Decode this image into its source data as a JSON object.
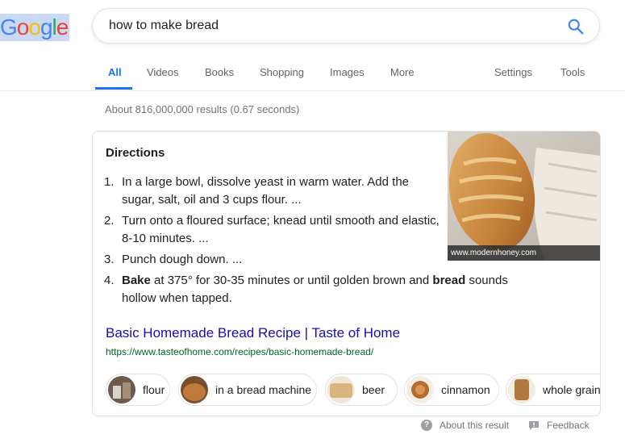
{
  "logo": {
    "letters": [
      "G",
      "o",
      "o",
      "g",
      "l",
      "e"
    ]
  },
  "search": {
    "query": "how to make bread"
  },
  "tabs": {
    "all": "All",
    "videos": "Videos",
    "books": "Books",
    "shopping": "Shopping",
    "images": "Images",
    "more": "More",
    "settings": "Settings",
    "tools": "Tools"
  },
  "result_stats": "About 816,000,000 results (0.67 seconds)",
  "snippet": {
    "title": "Directions",
    "steps": [
      {
        "num": "1.",
        "text": "In a large bowl, dissolve yeast in warm water. Add the sugar, salt, oil and 3 cups flour. ..."
      },
      {
        "num": "2.",
        "text": "Turn onto a floured surface; knead until smooth and elastic, 8-10 minutes. ..."
      },
      {
        "num": "3.",
        "text": "Punch dough down. ..."
      },
      {
        "num": "4.",
        "bold1": "Bake",
        "text_a": " at 375° for 30-35 minutes or until golden brown and ",
        "bold2": "bread",
        "text_b": " sounds hollow when tapped."
      }
    ],
    "image_caption": "www.modernhoney.com",
    "result_title": "Basic Homemade Bread Recipe | Taste of Home",
    "result_url": "https://www.tasteofhome.com/recipes/basic-homemade-bread/",
    "chips": [
      "flour",
      "in a bread machine",
      "beer",
      "cinnamon",
      "whole grain"
    ]
  },
  "footer": {
    "about": "About this result",
    "feedback": "Feedback"
  },
  "colors": {
    "link": "#1a0dab",
    "url": "#006621",
    "accent": "#1a73e8"
  }
}
